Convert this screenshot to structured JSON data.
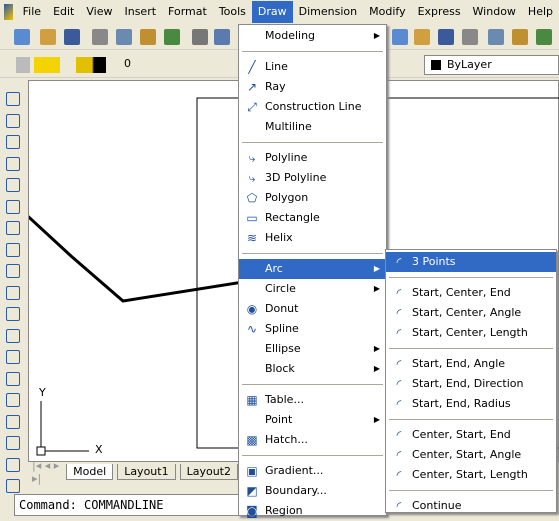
{
  "menubar": {
    "items": [
      "File",
      "Edit",
      "View",
      "Insert",
      "Format",
      "Tools",
      "Draw",
      "Dimension",
      "Modify",
      "Express",
      "Window",
      "Help"
    ],
    "active": "Draw"
  },
  "layer": {
    "name": "0",
    "color_control": "ByLayer"
  },
  "draw_menu": {
    "items": [
      {
        "label": "Modeling",
        "icon": "none",
        "submenu": true
      },
      {
        "sep": true
      },
      {
        "label": "Line",
        "icon": "line-icon"
      },
      {
        "label": "Ray",
        "icon": "ray-icon"
      },
      {
        "label": "Construction Line",
        "icon": "xline-icon"
      },
      {
        "label": "Multiline",
        "icon": "none"
      },
      {
        "sep": true
      },
      {
        "label": "Polyline",
        "icon": "polyline-icon"
      },
      {
        "label": "3D Polyline",
        "icon": "3dpolyline-icon"
      },
      {
        "label": "Polygon",
        "icon": "polygon-icon"
      },
      {
        "label": "Rectangle",
        "icon": "rectangle-icon"
      },
      {
        "label": "Helix",
        "icon": "helix-icon"
      },
      {
        "sep": true
      },
      {
        "label": "Arc",
        "icon": "none",
        "submenu": true,
        "highlighted": true
      },
      {
        "label": "Circle",
        "icon": "none",
        "submenu": true
      },
      {
        "label": "Donut",
        "icon": "donut-icon"
      },
      {
        "label": "Spline",
        "icon": "spline-icon"
      },
      {
        "label": "Ellipse",
        "icon": "none",
        "submenu": true
      },
      {
        "label": "Block",
        "icon": "none",
        "submenu": true
      },
      {
        "sep": true
      },
      {
        "label": "Table...",
        "icon": "table-icon"
      },
      {
        "label": "Point",
        "icon": "none",
        "submenu": true
      },
      {
        "label": "Hatch...",
        "icon": "hatch-icon"
      },
      {
        "sep": true
      },
      {
        "label": "Gradient...",
        "icon": "gradient-icon"
      },
      {
        "label": "Boundary...",
        "icon": "boundary-icon"
      },
      {
        "label": "Region",
        "icon": "region-icon"
      }
    ]
  },
  "arc_menu": {
    "items": [
      {
        "label": "3 Points",
        "highlighted": true
      },
      {
        "sep": true
      },
      {
        "label": "Start, Center, End"
      },
      {
        "label": "Start, Center, Angle"
      },
      {
        "label": "Start, Center, Length"
      },
      {
        "sep": true
      },
      {
        "label": "Start, End, Angle"
      },
      {
        "label": "Start, End, Direction"
      },
      {
        "label": "Start, End, Radius"
      },
      {
        "sep": true
      },
      {
        "label": "Center, Start, End"
      },
      {
        "label": "Center, Start, Angle"
      },
      {
        "label": "Center, Start, Length"
      },
      {
        "sep": true
      },
      {
        "label": "Continue"
      }
    ]
  },
  "ucs": {
    "x": "X",
    "y": "Y"
  },
  "tabs": [
    "Model",
    "Layout1",
    "Layout2"
  ],
  "command_line": "Command: COMMANDLINE",
  "colors": {
    "highlight": "#316ac5",
    "menubar": "#ece9d8"
  }
}
